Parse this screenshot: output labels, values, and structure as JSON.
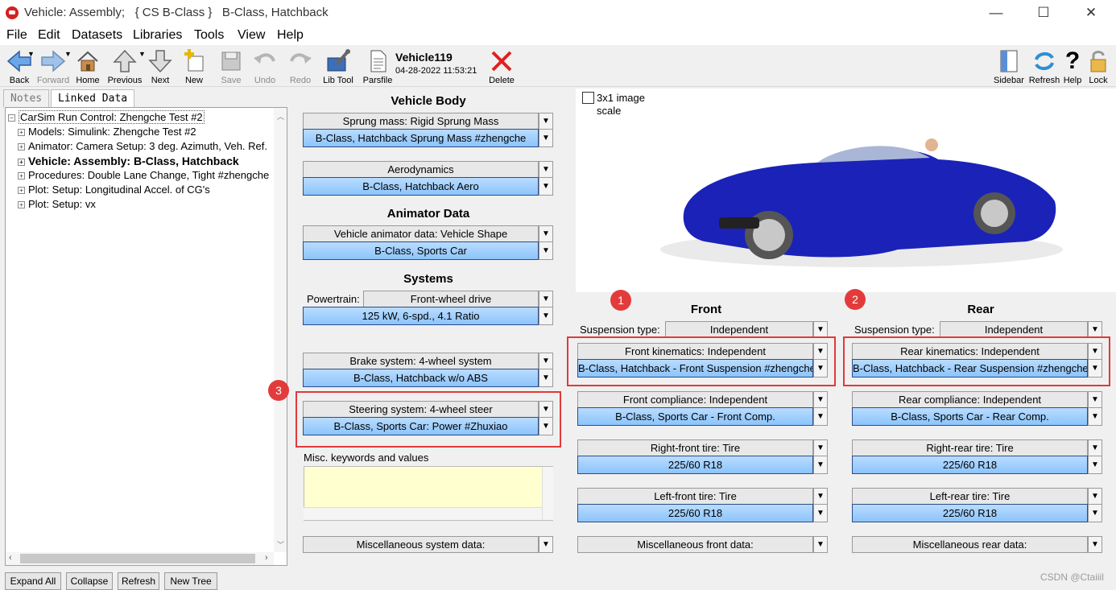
{
  "window": {
    "title": "Vehicle: Assembly;   { CS B-Class }   B-Class, Hatchback",
    "minimize": "—",
    "maximize": "☐",
    "close": "✕"
  },
  "menu": [
    "File",
    "Edit",
    "Datasets",
    "Libraries",
    "Tools",
    "View",
    "Help"
  ],
  "toolbar": {
    "back": "Back",
    "forward": "Forward",
    "home": "Home",
    "previous": "Previous",
    "next": "Next",
    "new": "New",
    "save": "Save",
    "undo": "Undo",
    "redo": "Redo",
    "libtool": "Lib Tool",
    "parsfile": "Parsfile",
    "delete": "Delete",
    "sidebar": "Sidebar",
    "refresh": "Refresh",
    "help": "Help",
    "lock": "Lock",
    "dataset_name": "Vehicle119",
    "dataset_date": "04-28-2022 11:53:21"
  },
  "left_tabs": {
    "notes": "Notes",
    "linked": "Linked Data"
  },
  "tree": [
    "CarSim Run Control: Zhengche Test #2",
    "Models: Simulink: Zhengche Test #2",
    "Animator: Camera Setup: 3 deg. Azimuth, Veh. Ref.",
    "Vehicle: Assembly: B-Class, Hatchback",
    "Procedures: Double Lane Change, Tight #zhengche",
    "Plot: Setup: Longitudinal Accel. of CG's",
    "Plot: Setup: vx"
  ],
  "tree_buttons": [
    "Expand All",
    "Collapse",
    "Refresh",
    "New Tree"
  ],
  "vehicle_body": {
    "title": "Vehicle Body",
    "sprung_hdr": "Sprung mass: Rigid Sprung Mass",
    "sprung_val": "B-Class, Hatchback Sprung Mass #zhengche",
    "aero_hdr": "Aerodynamics",
    "aero_val": "B-Class, Hatchback Aero"
  },
  "animator": {
    "title": "Animator Data",
    "hdr": "Vehicle animator data: Vehicle Shape",
    "val": "B-Class, Sports Car"
  },
  "systems": {
    "title": "Systems",
    "powertrain_label": "Powertrain:",
    "powertrain_type": "Front-wheel drive",
    "powertrain_val": "125 kW, 6-spd., 4.1 Ratio",
    "brake_hdr": "Brake system: 4-wheel system",
    "brake_val": "B-Class, Hatchback w/o ABS",
    "steer_hdr": "Steering system: 4-wheel steer",
    "steer_val": "B-Class, Sports Car: Power #Zhuxiao",
    "misc_label": "Misc. keywords and values",
    "misc_sys": "Miscellaneous system data:"
  },
  "image": {
    "checkbox_label_1": "3x1 image",
    "checkbox_label_2": "scale"
  },
  "badges": [
    "1",
    "2",
    "3"
  ],
  "front": {
    "title": "Front",
    "susp_label": "Suspension type:",
    "susp_type": "Independent",
    "kin_hdr": "Front kinematics: Independent",
    "kin_val": "B-Class, Hatchback - Front Suspension #zhengche",
    "comp_hdr": "Front compliance: Independent",
    "comp_val": "B-Class, Sports Car - Front Comp.",
    "rtire_hdr": "Right-front tire: Tire",
    "rtire_val": "225/60 R18",
    "ltire_hdr": "Left-front tire: Tire",
    "ltire_val": "225/60 R18",
    "misc": "Miscellaneous front data:"
  },
  "rear": {
    "title": "Rear",
    "susp_label": "Suspension type:",
    "susp_type": "Independent",
    "kin_hdr": "Rear kinematics: Independent",
    "kin_val": "B-Class, Hatchback - Rear Suspension #zhengche",
    "comp_hdr": "Rear compliance: Independent",
    "comp_val": "B-Class, Sports Car - Rear Comp.",
    "rtire_hdr": "Right-rear tire: Tire",
    "rtire_val": "225/60 R18",
    "ltire_hdr": "Left-rear tire: Tire",
    "ltire_val": "225/60 R18",
    "misc": "Miscellaneous rear data:"
  },
  "watermark": "CSDN @Ctaiiil",
  "colors": {
    "accent_blue": "#8cc4fb",
    "highlight_red": "#e03a3a",
    "misc_yellow": "#ffffd0"
  }
}
